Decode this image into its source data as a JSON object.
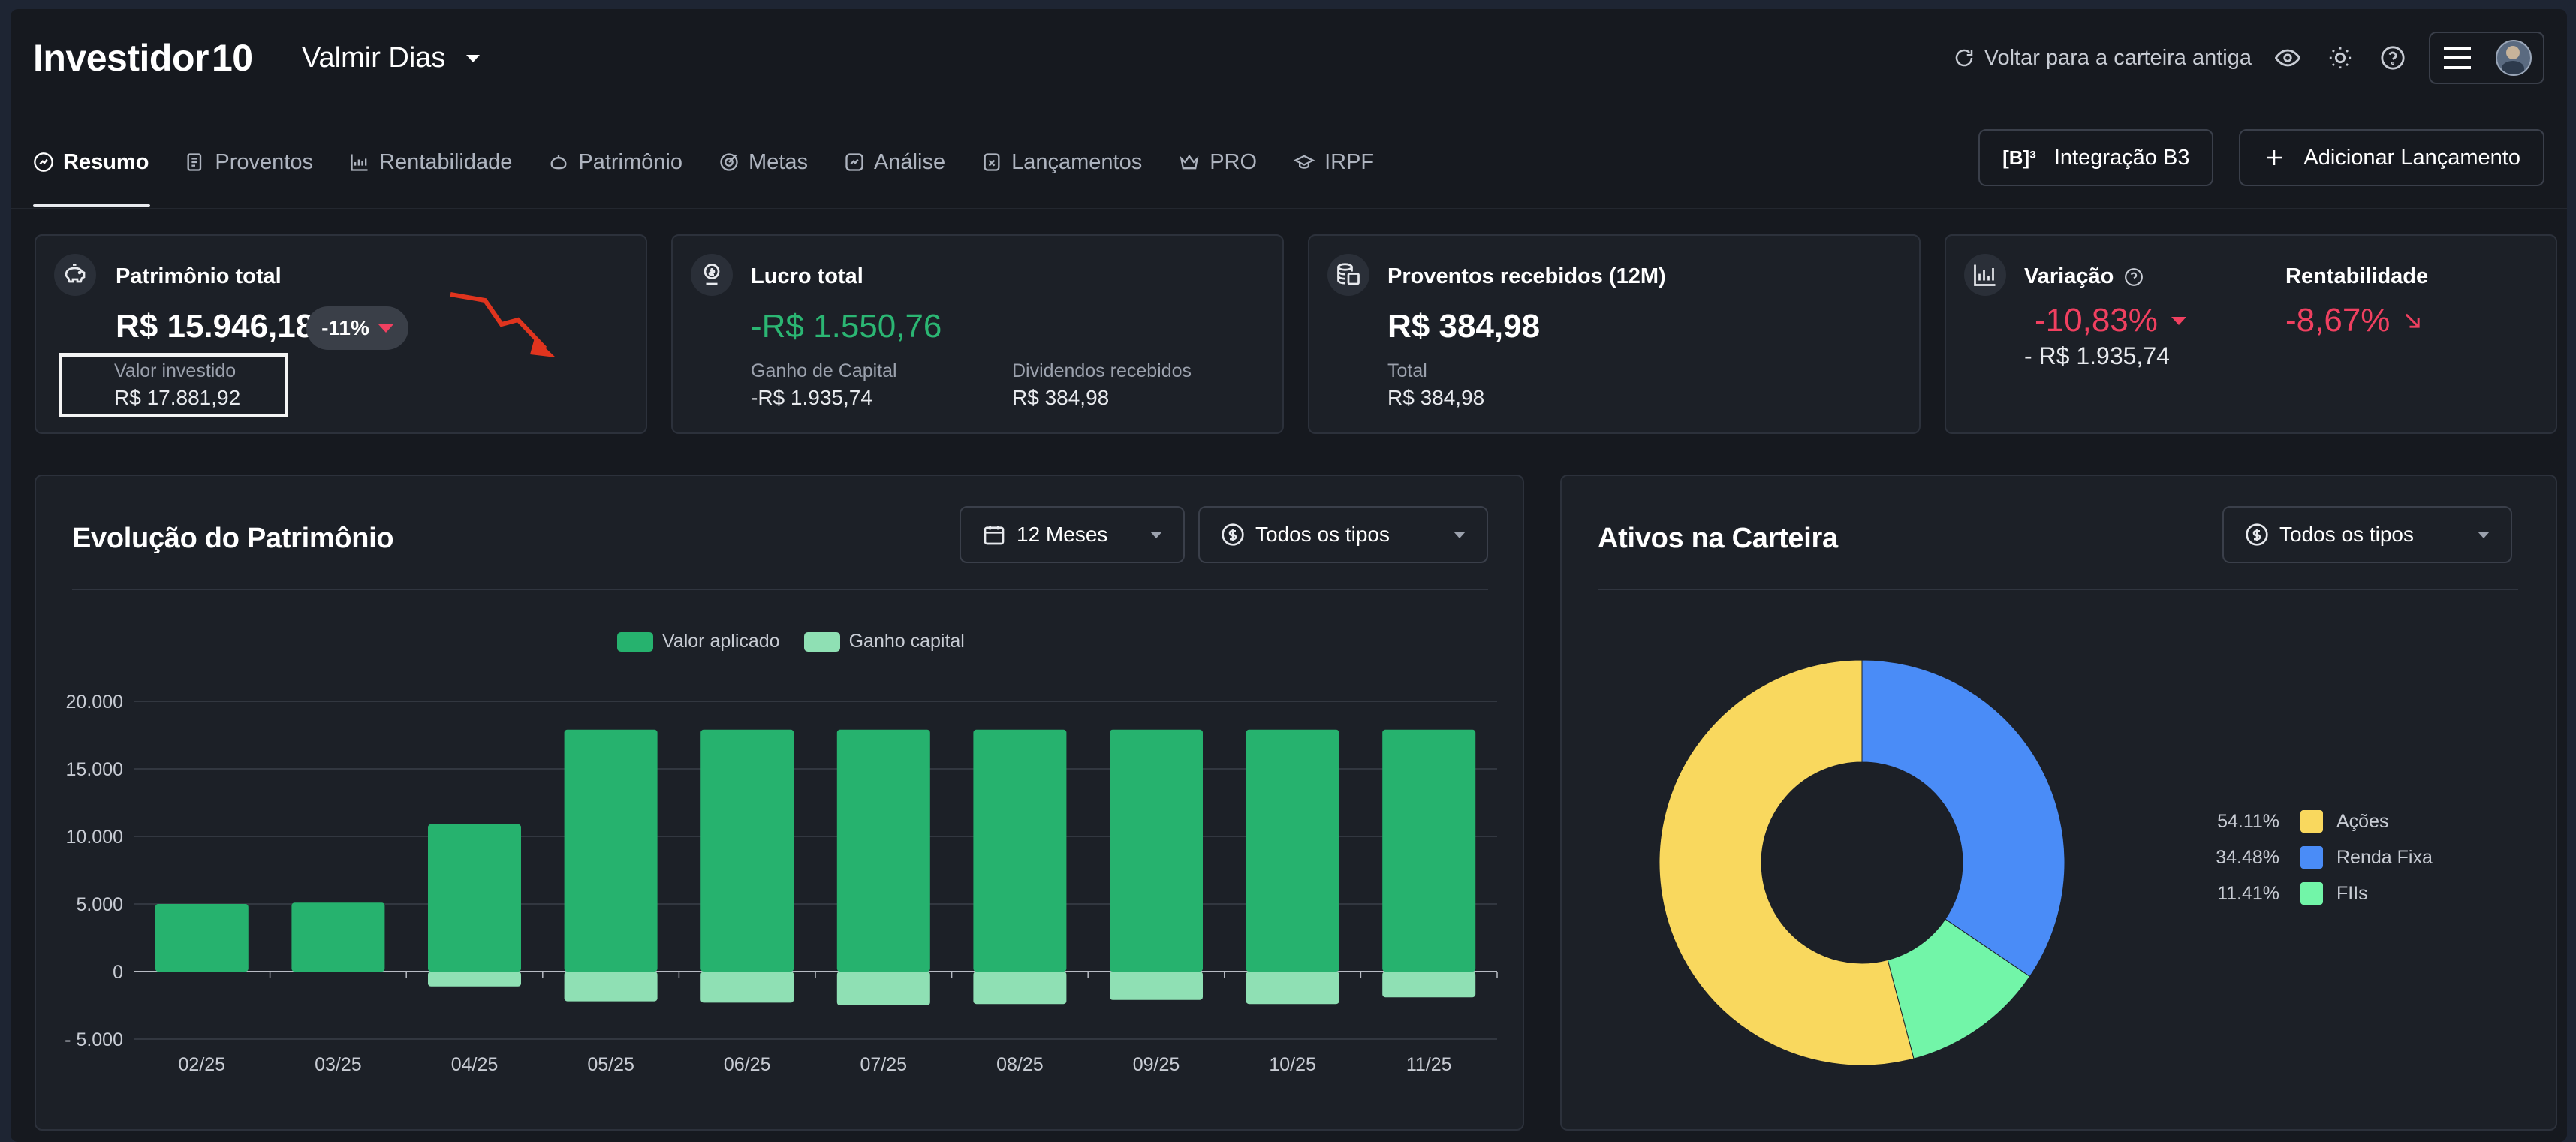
{
  "header": {
    "logo_text": "Investidor",
    "logo_num": "10",
    "user_name": "Valmir Dias",
    "back_link": "Voltar para a carteira antiga"
  },
  "nav": {
    "tabs": [
      {
        "label": "Resumo",
        "icon": "resumo-icon"
      },
      {
        "label": "Proventos",
        "icon": "proventos-icon"
      },
      {
        "label": "Rentabilidade",
        "icon": "rentabilidade-icon"
      },
      {
        "label": "Patrimônio",
        "icon": "patrimonio-icon"
      },
      {
        "label": "Metas",
        "icon": "metas-icon"
      },
      {
        "label": "Análise",
        "icon": "analise-icon"
      },
      {
        "label": "Lançamentos",
        "icon": "lancamentos-icon"
      },
      {
        "label": "PRO",
        "icon": "pro-crown-icon"
      },
      {
        "label": "IRPF",
        "icon": "irpf-icon"
      }
    ],
    "b3_logo": "[B]³",
    "b3_button": "Integração B3",
    "add_button": "Adicionar Lançamento"
  },
  "cards": {
    "patrimonio": {
      "title": "Patrimônio total",
      "value": "R$ 15.946,18",
      "badge": "-11%",
      "sub_label": "Valor investido",
      "sub_value": "R$ 17.881,92"
    },
    "lucro": {
      "title": "Lucro total",
      "value": "-R$ 1.550,76",
      "left_label": "Ganho de Capital",
      "left_value": "-R$ 1.935,74",
      "right_label": "Dividendos recebidos",
      "right_value": "R$ 384,98"
    },
    "proventos": {
      "title": "Proventos recebidos (12M)",
      "value": "R$ 384,98",
      "sub_label": "Total",
      "sub_value": "R$ 384,98"
    },
    "variacao": {
      "title": "Variação",
      "value": "-10,83%",
      "sub_value": "- R$ 1.935,74",
      "rent_title": "Rentabilidade",
      "rent_value": "-8,67%"
    }
  },
  "evolucao": {
    "title": "Evolução do Patrimônio",
    "period": "12 Meses",
    "type": "Todos os tipos"
  },
  "ativos": {
    "title": "Ativos na Carteira",
    "type": "Todos os tipos"
  },
  "colors": {
    "valor_aplicado": "#26b26e",
    "ganho_capital": "#8fe0b4",
    "acoes": "#f9d85e",
    "renda_fixa": "#4a8cf7",
    "fiis": "#72f5a8",
    "negative": "#f04060",
    "positive": "#2bb673"
  },
  "chart_data": [
    {
      "type": "bar",
      "categories": [
        "02/25",
        "03/25",
        "04/25",
        "05/25",
        "06/25",
        "07/25",
        "08/25",
        "09/25",
        "10/25",
        "11/25"
      ],
      "series": [
        {
          "name": "Valor aplicado",
          "values": [
            5000,
            5100,
            10900,
            17900,
            17900,
            17900,
            17900,
            17900,
            17900,
            17900
          ]
        },
        {
          "name": "Ganho capital",
          "values": [
            0,
            0,
            -1100,
            -2200,
            -2300,
            -2500,
            -2400,
            -2100,
            -2400,
            -1900
          ]
        }
      ],
      "ylim": [
        -5000,
        20000
      ],
      "yticks": [
        "- 5.000",
        "0",
        "5.000",
        "10.000",
        "15.000",
        "20.000"
      ],
      "ytick_values": [
        -5000,
        0,
        5000,
        10000,
        15000,
        20000
      ],
      "legend": "top-center"
    },
    {
      "type": "pie",
      "donut": true,
      "labels": [
        "Ações",
        "Renda Fixa",
        "FIIs"
      ],
      "values": [
        54.11,
        34.48,
        11.41
      ],
      "pct_labels": [
        "54.11%",
        "34.48%",
        "11.41%"
      ],
      "legend": "right"
    }
  ]
}
